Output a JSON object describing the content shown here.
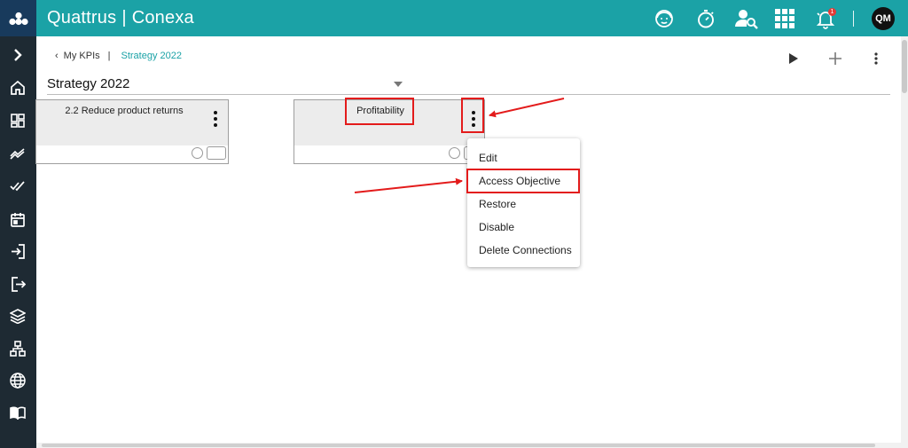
{
  "app": {
    "brand_left": "Quattrus",
    "brand_sep": "|",
    "brand_right": "Conexa",
    "user_initials": "QM",
    "notification_count": "1"
  },
  "topbar_icons": [
    "support-agent-icon",
    "stopwatch-icon",
    "user-search-icon",
    "apps-grid-icon",
    "bell-icon"
  ],
  "sidebar_icons": [
    "chevron-right-icon",
    "home-icon",
    "dashboard-icon",
    "trend-icon",
    "double-check-icon",
    "calendar-icon",
    "login-icon",
    "logout-icon",
    "layers-icon",
    "org-chart-icon",
    "globe-icon",
    "book-icon"
  ],
  "breadcrumb": {
    "back_glyph": "‹",
    "parent": "My KPIs",
    "separator": "|",
    "current": "Strategy 2022"
  },
  "toolbar": [
    "play-icon",
    "plus-icon",
    "more-vertical-icon"
  ],
  "page": {
    "title": "Strategy 2022"
  },
  "cards": [
    {
      "title": "2.2 Reduce product returns"
    },
    {
      "title": "Profitability"
    }
  ],
  "menu": {
    "items": [
      "Edit",
      "Access Objective",
      "Restore",
      "Disable",
      "Delete Connections"
    ]
  },
  "colors": {
    "topbar": "#1ba2a6",
    "brand_box": "#183a5c",
    "sidebar": "#1e2a33",
    "accent_text": "#1ba2a6",
    "highlight": "#e31b1b"
  }
}
